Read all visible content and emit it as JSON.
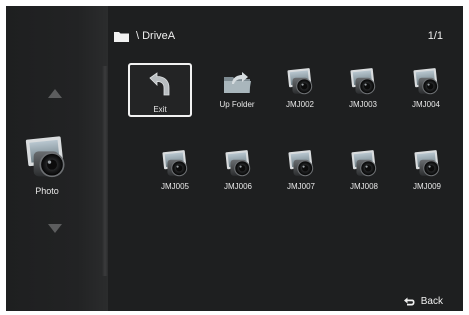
{
  "header": {
    "folder_icon": "folder-icon",
    "path": "\\ DriveA",
    "page_indicator": "1/1"
  },
  "sidebar": {
    "up_icon": "arrow-up-icon",
    "down_icon": "arrow-down-icon",
    "media_type_label": "Photo",
    "media_type_icon": "photo-stack-icon"
  },
  "items": [
    {
      "label": "Exit",
      "icon": "exit-arrow-icon",
      "selected": true
    },
    {
      "label": "Up Folder",
      "icon": "up-folder-icon",
      "selected": false
    },
    {
      "label": "JMJ002",
      "icon": "photo-file-icon",
      "selected": false
    },
    {
      "label": "JMJ003",
      "icon": "photo-file-icon",
      "selected": false
    },
    {
      "label": "JMJ004",
      "icon": "photo-file-icon",
      "selected": false
    },
    {
      "label": "JMJ005",
      "icon": "photo-file-icon",
      "selected": false
    },
    {
      "label": "JMJ006",
      "icon": "photo-file-icon",
      "selected": false
    },
    {
      "label": "JMJ007",
      "icon": "photo-file-icon",
      "selected": false
    },
    {
      "label": "JMJ008",
      "icon": "photo-file-icon",
      "selected": false
    },
    {
      "label": "JMJ009",
      "icon": "photo-file-icon",
      "selected": false
    }
  ],
  "footer": {
    "back_label": "Back",
    "back_icon": "return-arrow-icon"
  },
  "colors": {
    "background": "#1e1f20",
    "text": "#f0f0f0",
    "selection_border": "#f2f2f2",
    "arrow": "#5c5d5e"
  }
}
